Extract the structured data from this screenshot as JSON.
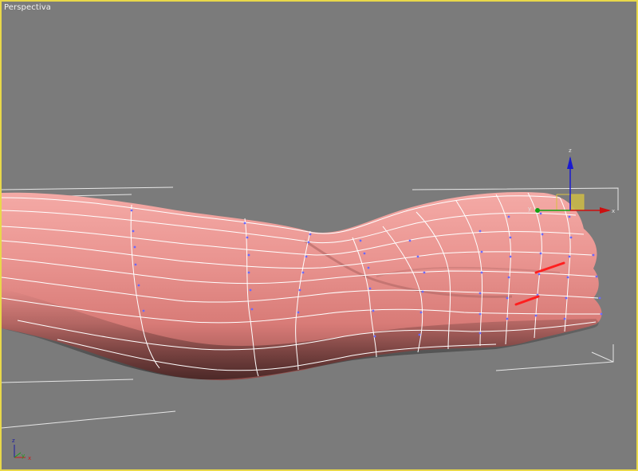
{
  "viewport": {
    "label": "Perspectiva",
    "border_color": "#e8d84a",
    "background": "#7b7b7b"
  },
  "mesh": {
    "object": "arm",
    "color": "#e8928f",
    "wire_color": "#ffffff",
    "vertex_color": "#3a3aff",
    "selected_edge_color": "#ff1f1f"
  },
  "gizmo": {
    "labels": {
      "x": "x",
      "y": "y",
      "z": "z"
    },
    "colors": {
      "x": "#cc1010",
      "y": "#10a010",
      "z": "#1010d0",
      "plane": "#d8c040"
    }
  },
  "world_axis": {
    "labels": {
      "x": "x",
      "y": "y",
      "z": "z"
    },
    "colors": {
      "x": "#d01818",
      "y": "#18a018",
      "z": "#1a1aa0"
    }
  }
}
